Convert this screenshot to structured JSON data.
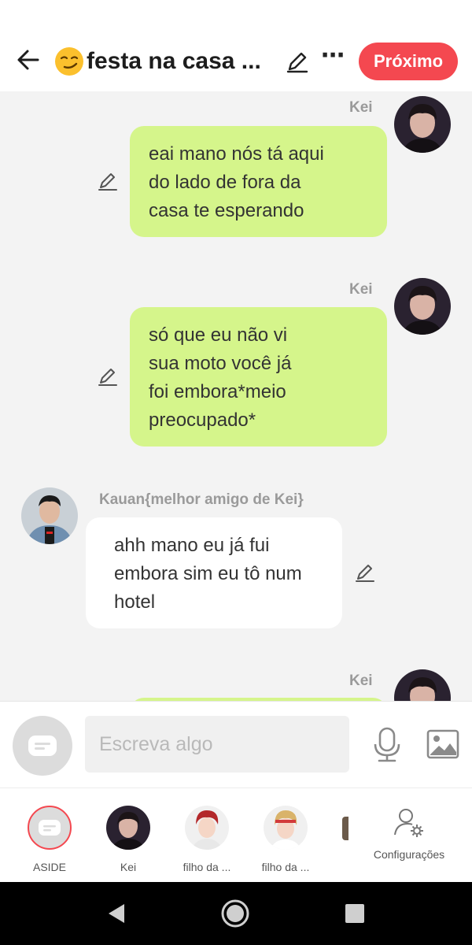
{
  "header": {
    "title": "festa na casa ...",
    "next_label": "Próximo"
  },
  "messages": [
    {
      "sender": "Kei",
      "text_lines": [
        "eai mano nós tá aqui",
        "do lado de fora da",
        "casa te esperando"
      ]
    },
    {
      "sender": "Kei",
      "text_lines": [
        "só que eu não vi",
        "sua moto você já",
        "foi embora*meio",
        "preocupado*"
      ]
    },
    {
      "sender": "Kauan{melhor amigo de Kei}",
      "text_lines": [
        "ahh mano eu já fui",
        "embora sim eu tô num",
        "hotel"
      ]
    },
    {
      "sender": "Kei"
    }
  ],
  "composer": {
    "placeholder": "Escreva algo"
  },
  "bottom_nav": {
    "items": [
      {
        "label": "ASIDE"
      },
      {
        "label": "Kei"
      },
      {
        "label": "filho da ..."
      },
      {
        "label": "filho da ..."
      },
      {
        "label": "Configurações"
      }
    ]
  },
  "colors": {
    "accent": "#f44850",
    "outgoing_bubble": "#d5f58b",
    "incoming_bubble": "#ffffff"
  }
}
